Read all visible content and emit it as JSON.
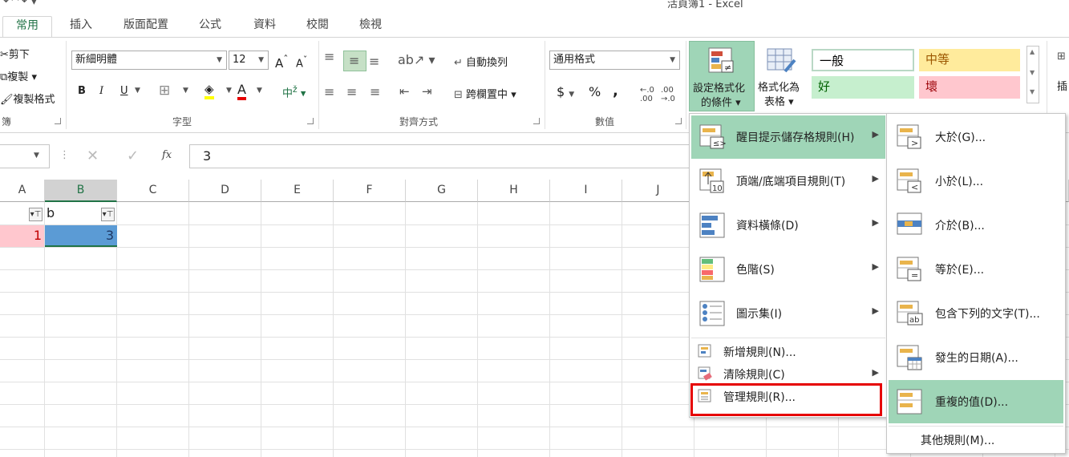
{
  "window": {
    "title": "活頁簿1 - Excel"
  },
  "tabs": [
    "常用",
    "插入",
    "版面配置",
    "公式",
    "資料",
    "校閱",
    "檢視"
  ],
  "clipboard": {
    "cut": "剪下",
    "copy": "複製",
    "format_painter": "複製格式",
    "group": "簿"
  },
  "font": {
    "name": "新細明體",
    "size": "12",
    "group": "字型",
    "bold": "B",
    "italic": "I",
    "underline": "U",
    "phonetic": "中"
  },
  "alignment": {
    "wrap": "自動換列",
    "merge": "跨欄置中",
    "group": "對齊方式"
  },
  "number": {
    "format": "通用格式",
    "currency": "$",
    "percent": "%",
    "comma": ",",
    "inc_dec": ".0 .00",
    "group": "數值"
  },
  "styles": {
    "cond_fmt_line1": "設定格式化",
    "cond_fmt_line2": "的條件",
    "format_table_line1": "格式化為",
    "format_table_line2": "表格",
    "normal": "一般",
    "neutral": "中等",
    "good": "好",
    "bad": "壞",
    "insert": "插"
  },
  "formula_bar": {
    "content": "3",
    "fx": "fx"
  },
  "columns": [
    "A",
    "B",
    "C",
    "D",
    "E",
    "F",
    "G",
    "H",
    "I",
    "J"
  ],
  "cells": {
    "b1": "b",
    "a2": "1",
    "b2": "3"
  },
  "menu": {
    "items": [
      {
        "label": "醒目提示儲存格規則(H)",
        "icon": "highlight-rules-icon"
      },
      {
        "label": "頂端/底端項目規則(T)",
        "icon": "top-bottom-rules-icon"
      },
      {
        "label": "資料橫條(D)",
        "icon": "data-bars-icon"
      },
      {
        "label": "色階(S)",
        "icon": "color-scales-icon"
      },
      {
        "label": "圖示集(I)",
        "icon": "icon-sets-icon"
      }
    ],
    "small_items": [
      {
        "label": "新增規則(N)...",
        "icon": "new-rule-icon"
      },
      {
        "label": "清除規則(C)",
        "icon": "clear-rules-icon"
      },
      {
        "label": "管理規則(R)...",
        "icon": "manage-rules-icon"
      }
    ]
  },
  "submenu": {
    "items": [
      {
        "label": "大於(G)...",
        "icon": "greater-than-icon"
      },
      {
        "label": "小於(L)...",
        "icon": "less-than-icon"
      },
      {
        "label": "介於(B)...",
        "icon": "between-icon"
      },
      {
        "label": "等於(E)...",
        "icon": "equal-to-icon"
      },
      {
        "label": "包含下列的文字(T)...",
        "icon": "text-contains-icon"
      },
      {
        "label": "發生的日期(A)...",
        "icon": "date-occurring-icon"
      },
      {
        "label": "重複的值(D)...",
        "icon": "duplicate-values-icon"
      }
    ],
    "more": "其他規則(M)..."
  },
  "colors": {
    "accent": "#217346",
    "highlight": "#9fd5b7",
    "red_box": "#e60000",
    "cell_a2": "#ffc7ce",
    "cell_b2": "#5b9bd5"
  }
}
